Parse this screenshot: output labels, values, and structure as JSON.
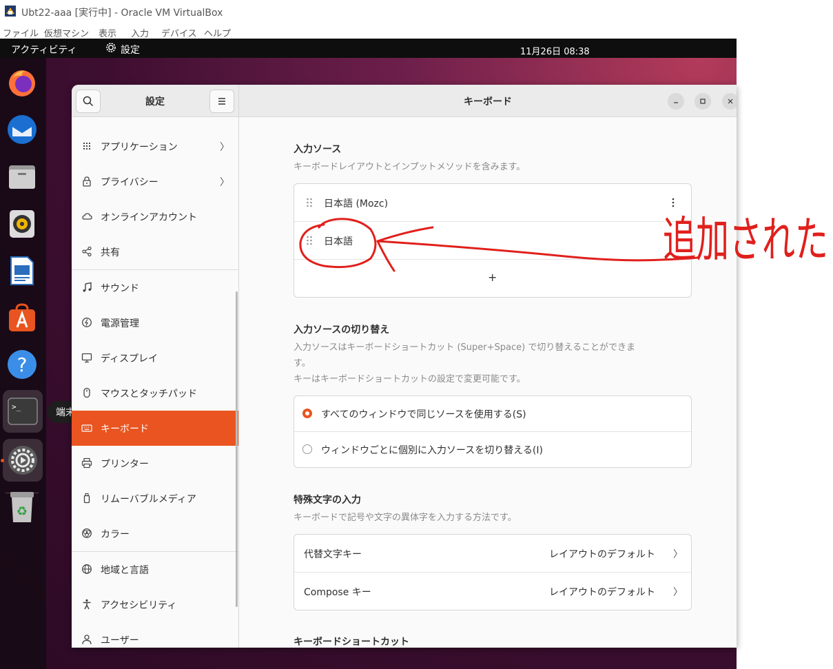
{
  "vbox": {
    "title": "Ubt22-aaa [実行中] - Oracle VM VirtualBox",
    "menu": [
      "ファイル",
      "仮想マシン",
      "表示",
      "入力",
      "デバイス",
      "ヘルプ"
    ]
  },
  "topbar": {
    "activities": "アクティビティ",
    "app_name": "設定",
    "clock": "11月26日  08:38"
  },
  "dock": {
    "items": [
      "firefox-icon",
      "thunderbird-icon",
      "files-icon",
      "rhythmbox-icon",
      "libreoffice-writer-icon",
      "app-center-icon",
      "help-icon",
      "terminal-icon",
      "settings-icon",
      "trash-icon"
    ],
    "tooltip": "端末"
  },
  "settings": {
    "sidebar_title": "設定",
    "main_title": "キーボード",
    "sidebar_items": [
      {
        "label": "アプリケーション",
        "icon": "apps-grid-icon",
        "chevron": "〉"
      },
      {
        "label": "プライバシー",
        "icon": "lock-icon",
        "chevron": "〉"
      },
      {
        "label": "オンラインアカウント",
        "icon": "cloud-icon"
      },
      {
        "label": "共有",
        "icon": "share-icon"
      },
      {
        "label": "サウンド",
        "icon": "music-note-icon"
      },
      {
        "label": "電源管理",
        "icon": "power-icon"
      },
      {
        "label": "ディスプレイ",
        "icon": "display-icon"
      },
      {
        "label": "マウスとタッチパッド",
        "icon": "mouse-icon"
      },
      {
        "label": "キーボード",
        "icon": "keyboard-icon",
        "selected": true
      },
      {
        "label": "プリンター",
        "icon": "printer-icon"
      },
      {
        "label": "リムーバブルメディア",
        "icon": "removable-media-icon"
      },
      {
        "label": "カラー",
        "icon": "color-icon"
      },
      {
        "label": "地域と言語",
        "icon": "globe-icon"
      },
      {
        "label": "アクセシビリティ",
        "icon": "accessibility-icon"
      },
      {
        "label": "ユーザー",
        "icon": "user-icon"
      }
    ]
  },
  "keyboard": {
    "input_sources": {
      "title": "入力ソース",
      "desc": "キーボードレイアウトとインプットメソッドを含みます。",
      "items": [
        "日本語 (Mozc)",
        "日本語"
      ],
      "add_symbol": "+"
    },
    "switching": {
      "title": "入力ソースの切り替え",
      "desc_line1": "入力ソースはキーボードショートカット (Super+Space) で切り替えることができま",
      "desc_line2": "す。",
      "desc_line3": "キーはキーボードショートカットの設定で変更可能です。",
      "options": [
        "すべてのウィンドウで同じソースを使用する(S)",
        "ウィンドウごとに個別に入力ソースを切り替える(I)"
      ],
      "selected_index": 0
    },
    "special_chars": {
      "title": "特殊文字の入力",
      "desc": "キーボードで記号や文字の異体字を入力する方法です。",
      "rows": [
        {
          "label": "代替文字キー",
          "value": "レイアウトのデフォルト"
        },
        {
          "label": "Compose キー",
          "value": "レイアウトのデフォルト"
        }
      ]
    },
    "shortcuts": {
      "title": "キーボードショートカット"
    }
  },
  "annotation": {
    "text": "追加された",
    "color": "#e0201c"
  }
}
